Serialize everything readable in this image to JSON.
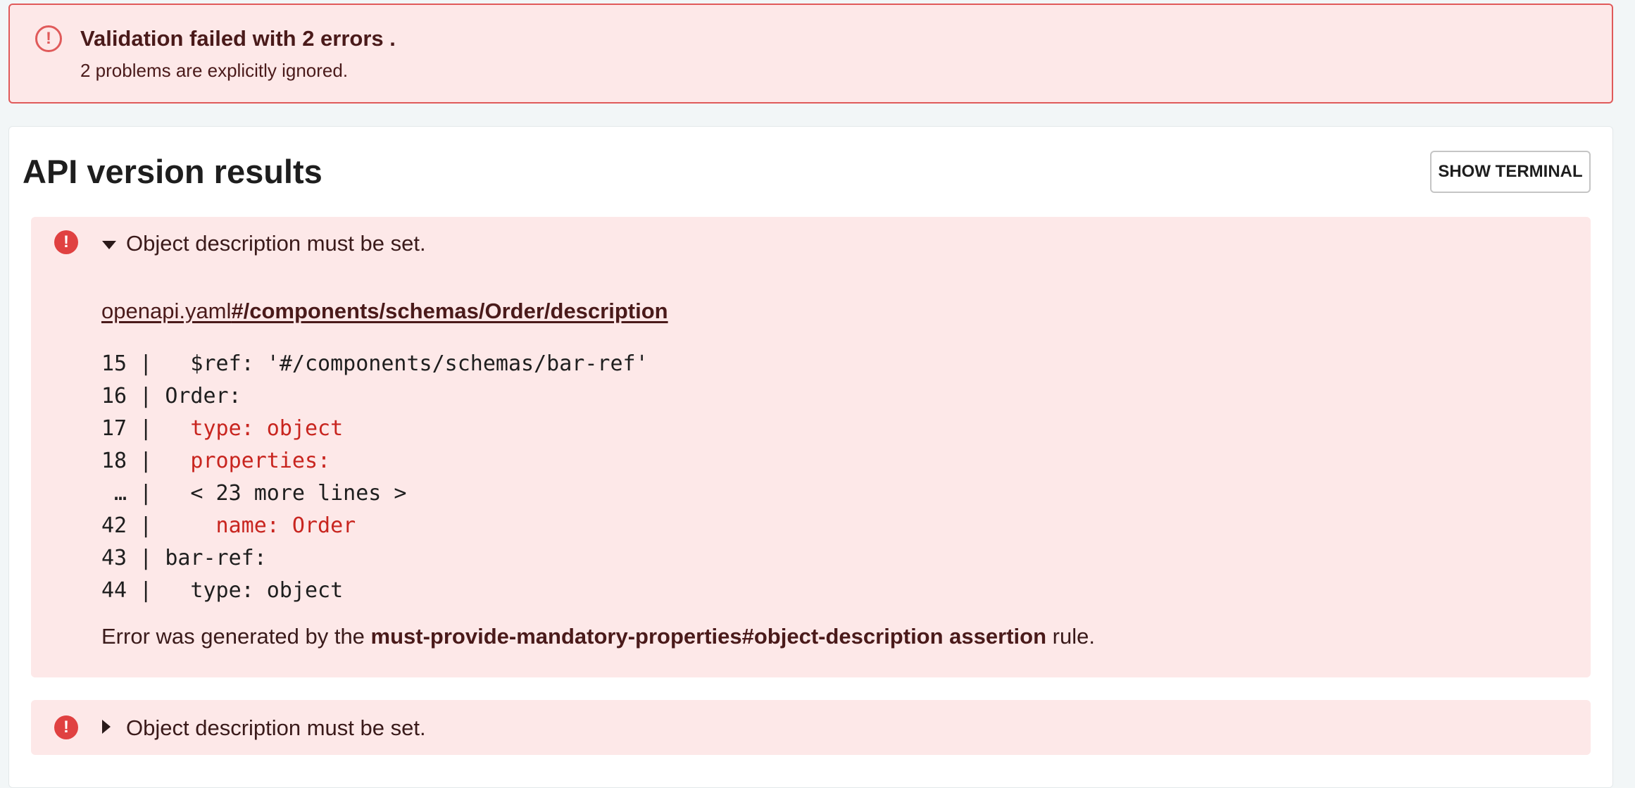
{
  "banner": {
    "icon": "alert-circle-icon",
    "title": "Validation failed with 2 errors .",
    "subtitle": "2 problems are explicitly ignored."
  },
  "results": {
    "title": "API version results",
    "terminal_button": "SHOW TERMINAL"
  },
  "problems": [
    {
      "icon": "error-icon",
      "title": "Object description must be set.",
      "expanded": true,
      "location_file": "openapi.yaml",
      "location_path": "#/components/schemas/Order/description",
      "code_lines": [
        {
          "num": "15",
          "sep": " | ",
          "text": "  $ref: '#/components/schemas/bar-ref'",
          "highlight": false
        },
        {
          "num": "16",
          "sep": " | ",
          "text": "Order:",
          "highlight": false
        },
        {
          "num": "17",
          "sep": " | ",
          "text": "  type: object",
          "highlight": true
        },
        {
          "num": "18",
          "sep": " | ",
          "text": "  properties:",
          "highlight": true
        },
        {
          "num": " …",
          "sep": " | ",
          "text": "  < 23 more lines >",
          "highlight": false
        },
        {
          "num": "42",
          "sep": " | ",
          "text": "    name: Order",
          "highlight": true
        },
        {
          "num": "43",
          "sep": " | ",
          "text": "bar-ref:",
          "highlight": false
        },
        {
          "num": "44",
          "sep": " | ",
          "text": "  type: object",
          "highlight": false
        }
      ],
      "rule_prefix": "Error was generated by the ",
      "rule_name": "must-provide-mandatory-properties#object-description assertion",
      "rule_suffix": " rule."
    },
    {
      "icon": "error-icon",
      "title": "Object description must be set.",
      "expanded": false
    }
  ],
  "colors": {
    "error_bg": "#fde8e8",
    "error_border": "#e05a5a",
    "error_icon": "#e04141",
    "highlight_text": "#c8251f"
  }
}
